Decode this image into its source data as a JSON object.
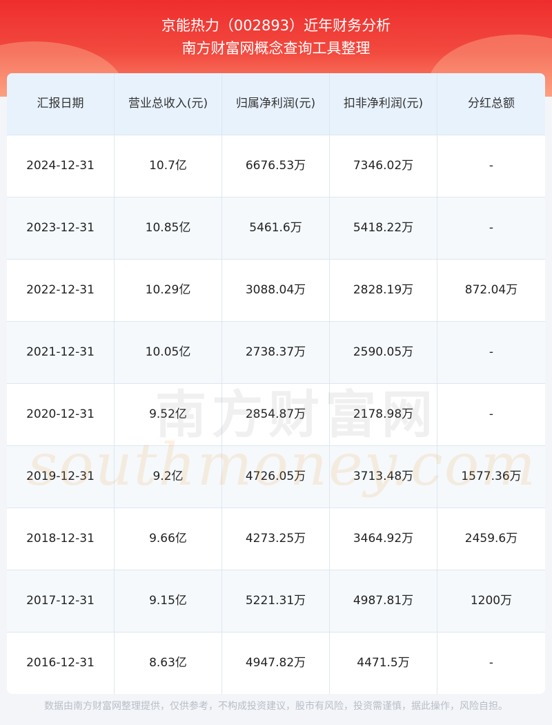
{
  "header": {
    "title": "京能热力（002893）近年财务分析",
    "subtitle": "南方财富网概念查询工具整理"
  },
  "table": {
    "columns": [
      "汇报日期",
      "营业总收入(元)",
      "归属净利润(元)",
      "扣非净利润(元)",
      "分红总额"
    ],
    "rows": [
      [
        "2024-12-31",
        "10.7亿",
        "6676.53万",
        "7346.02万",
        "-"
      ],
      [
        "2023-12-31",
        "10.85亿",
        "5461.6万",
        "5418.22万",
        "-"
      ],
      [
        "2022-12-31",
        "10.29亿",
        "3088.04万",
        "2828.19万",
        "872.04万"
      ],
      [
        "2021-12-31",
        "10.05亿",
        "2738.37万",
        "2590.05万",
        "-"
      ],
      [
        "2020-12-31",
        "9.52亿",
        "2854.87万",
        "2178.98万",
        "-"
      ],
      [
        "2019-12-31",
        "9.2亿",
        "4726.05万",
        "3713.48万",
        "1577.36万"
      ],
      [
        "2018-12-31",
        "9.66亿",
        "4273.25万",
        "3464.92万",
        "2459.6万"
      ],
      [
        "2017-12-31",
        "9.15亿",
        "5221.31万",
        "4987.81万",
        "1200万"
      ],
      [
        "2016-12-31",
        "8.63亿",
        "4947.82万",
        "4471.5万",
        "-"
      ]
    ]
  },
  "watermark": {
    "cn": "南方财富网",
    "en": "southmoney.com"
  },
  "footer": {
    "disclaimer": "数据由南方财富网整理提供，仅供参考，不构成投资建议，股市有风险，投资需谨慎，据此操作，风险自担。"
  },
  "colors": {
    "banner": "#ee2d2d",
    "header_row": "#e8f2fd",
    "alt_row": "#f5f9fc",
    "border": "#dde6f0"
  }
}
